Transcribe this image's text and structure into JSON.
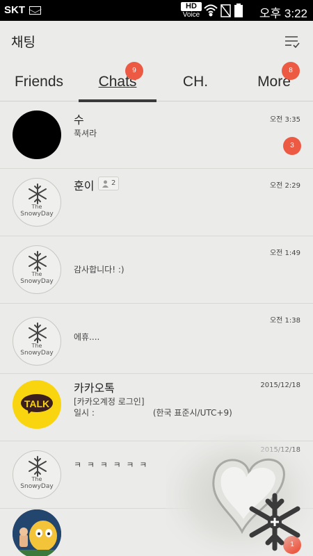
{
  "status_bar": {
    "carrier": "SKT",
    "hd": "HD",
    "voice": "Voice",
    "time": "오후 3:22",
    "icons": [
      "mail-icon",
      "wifi-icon",
      "no-sim-icon",
      "battery-icon"
    ]
  },
  "header": {
    "title": "채팅",
    "menu_icon": "edit-list-icon"
  },
  "tabs": [
    {
      "label": "Friends",
      "badge": ""
    },
    {
      "label": "Chats",
      "badge": "9"
    },
    {
      "label": "CH.",
      "badge": ""
    },
    {
      "label": "More",
      "badge": "8"
    }
  ],
  "chats": [
    {
      "name": "수",
      "preview": "푹셔라",
      "time": "오전 3:35",
      "unread": "3",
      "avatar": "black"
    },
    {
      "name": "훈이",
      "members": "2",
      "preview": "",
      "time": "오전 2:29",
      "avatar": "snowy-day"
    },
    {
      "name": "",
      "preview": "감사합니다! :)",
      "time": "오전 1:49",
      "avatar": "snowy-day"
    },
    {
      "name": "",
      "preview": "에휴....",
      "time": "오전 1:38",
      "avatar": "snowy-day"
    },
    {
      "name": "카카오톡",
      "preview": "[카카오계정 로그인]",
      "preview2": "일시 :                      (한국 표준시/UTC+9)",
      "time": "2015/12/18",
      "avatar": "kakao-talk"
    },
    {
      "name": "",
      "preview": "ㅋ ㅋ ㅋ ㅋ ㅋ ㅋ",
      "time": "2015/12/18",
      "avatar": "snowy-day"
    },
    {
      "name": "",
      "preview": "",
      "time": "",
      "unread": "1",
      "avatar": "cartoon"
    }
  ],
  "avatar_text": {
    "the": "The",
    "snowy_day": "SnowyDay",
    "talk": "TALK"
  },
  "fab_icon": "snowflake-plus-icon",
  "colors": {
    "badge": "#ec5a44",
    "background": "#ebebe9",
    "kakao_yellow": "#f9d50f"
  }
}
